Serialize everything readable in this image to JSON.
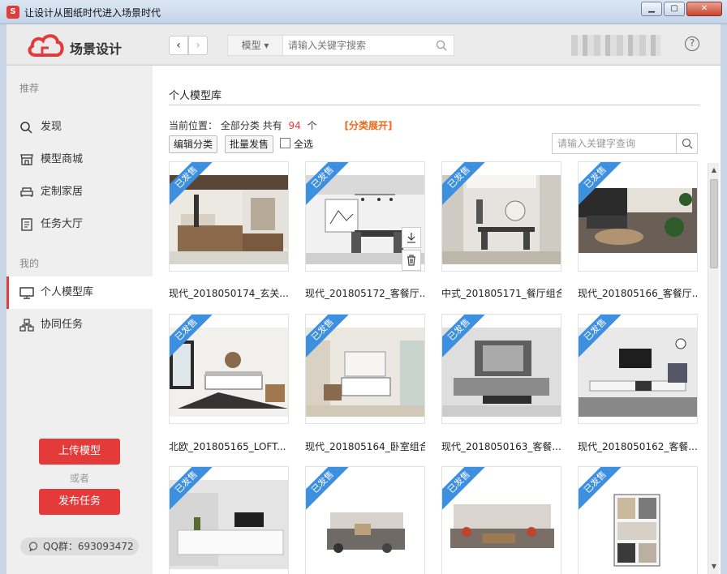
{
  "window": {
    "title": "让设计从图纸时代进入场景时代"
  },
  "header": {
    "logo_text": "场景设计",
    "search": {
      "category": "模型",
      "placeholder": "请输入关键字搜索"
    },
    "help": "?"
  },
  "sidebar": {
    "group_recommend": "推荐",
    "items_recommend": [
      {
        "label": "发现",
        "icon": "search-icon"
      },
      {
        "label": "模型商城",
        "icon": "store-icon"
      },
      {
        "label": "定制家居",
        "icon": "sofa-icon"
      },
      {
        "label": "任务大厅",
        "icon": "task-icon"
      }
    ],
    "group_mine": "我的",
    "items_mine": [
      {
        "label": "个人模型库",
        "icon": "monitor-icon",
        "active": true
      },
      {
        "label": "协同任务",
        "icon": "network-icon"
      }
    ],
    "upload_button": "上传模型",
    "or_text": "或者",
    "publish_button": "发布任务",
    "qq_group": "QQ群：693093472"
  },
  "main": {
    "title": "个人模型库",
    "location_prefix": "当前位置：",
    "location_path": "全部分类 共有",
    "count": "94",
    "count_unit": "个",
    "expand_link": "[分类展开]",
    "edit_category_button": "编辑分类",
    "batch_publish_button": "批量发售",
    "select_all_label": "全选",
    "lib_search_placeholder": "请输入关键字查询",
    "badge": "已发售",
    "models": [
      {
        "label": "现代_2018050174_玄关..."
      },
      {
        "label": "现代_201805172_客餐厅..."
      },
      {
        "label": "中式_201805171_餐厅组合"
      },
      {
        "label": "现代_201805166_客餐厅..."
      },
      {
        "label": "北欧_201805165_LOFT..."
      },
      {
        "label": "现代_201805164_卧室组合"
      },
      {
        "label": "现代_2018050163_客餐..."
      },
      {
        "label": "现代_2018050162_客餐..."
      },
      {
        "label": ""
      },
      {
        "label": ""
      },
      {
        "label": ""
      },
      {
        "label": ""
      }
    ]
  },
  "colors": {
    "accent": "#e53a3a",
    "badge": "#3d8fe0",
    "link": "#ee6a1a"
  }
}
